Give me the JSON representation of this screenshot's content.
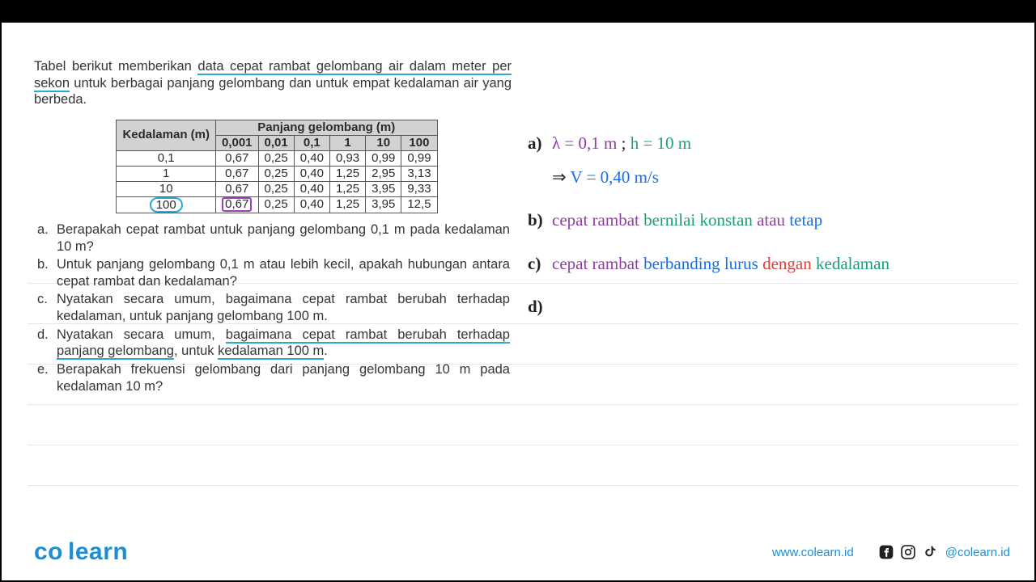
{
  "intro": {
    "pre": "Tabel berikut memberikan ",
    "u1": "data cepat rambat gelombang air dalam meter per sekon",
    "post": " untuk berbagai panjang gelombang dan untuk empat kedalaman air yang berbeda."
  },
  "table": {
    "head_depth": "Kedalaman (m)",
    "head_wavelength": "Panjang gelombang (m)",
    "cols": [
      "0,001",
      "0,01",
      "0,1",
      "1",
      "10",
      "100"
    ],
    "rows": [
      {
        "depth": "0,1",
        "vals": [
          "0,67",
          "0,25",
          "0,40",
          "0,93",
          "0,99",
          "0,99"
        ]
      },
      {
        "depth": "1",
        "vals": [
          "0,67",
          "0,25",
          "0,40",
          "1,25",
          "2,95",
          "3,13"
        ]
      },
      {
        "depth": "10",
        "vals": [
          "0,67",
          "0,25",
          "0,40",
          "1,25",
          "3,95",
          "9,33"
        ]
      },
      {
        "depth": "100",
        "vals": [
          "0,67",
          "0,25",
          "0,40",
          "1,25",
          "3,95",
          "12,5"
        ],
        "circleDepth": true,
        "boxFirst": true
      }
    ]
  },
  "questions": {
    "a": {
      "lbl": "a.",
      "txt": "Berapakah cepat rambat untuk panjang gelombang 0,1 m pada kedalaman 10 m?"
    },
    "b": {
      "lbl": "b.",
      "txt": "Untuk panjang gelombang 0,1 m atau lebih kecil, apakah hubungan antara cepat rambat dan kedalaman?"
    },
    "c": {
      "lbl": "c.",
      "txt": "Nyatakan secara umum, bagaimana cepat rambat berubah terhadap kedalaman, untuk panjang gelombang 100 m."
    },
    "d": {
      "lbl": "d.",
      "pre": "Nyatakan secara umum, ",
      "u1": "bagaimana cepat rambat berubah terhadap panjang gelombang",
      "mid": ", untuk ",
      "u2": "kedalaman 100 m",
      "post": "."
    },
    "e": {
      "lbl": "e.",
      "txt": "Berapakah frekuensi gelombang dari panjang gelombang 10 m pada kedalaman 10 m?"
    }
  },
  "answers": {
    "a": {
      "lbl": "a)",
      "line1": {
        "p1": "λ = 0,1 m ",
        "p2": "; ",
        "p3": "h = 10 m"
      },
      "line2": {
        "arrow": "⇒ ",
        "eq": "V = 0,40 m/s"
      }
    },
    "b": {
      "lbl": "b)",
      "s1": "cepat rambat ",
      "s2": "bernilai konstan ",
      "s3": "atau ",
      "s4": "tetap"
    },
    "c": {
      "lbl": "c)",
      "s1": "cepat rambat ",
      "s2": "berbanding lurus ",
      "s3": "dengan ",
      "s4": "kedalaman"
    },
    "d": {
      "lbl": "d)"
    }
  },
  "footer": {
    "brand1": "co",
    "brand2": "learn",
    "url": "www.colearn.id",
    "handle": "@colearn.id"
  }
}
